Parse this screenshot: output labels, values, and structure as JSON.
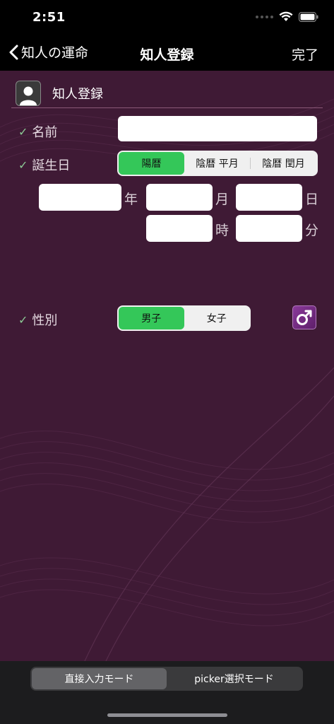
{
  "status_bar": {
    "time": "2:51"
  },
  "nav": {
    "back_label": "知人の運命",
    "title": "知人登録",
    "done_label": "完了"
  },
  "section": {
    "title": "知人登録"
  },
  "name_field": {
    "label": "名前",
    "value": ""
  },
  "birthday": {
    "label": "誕生日",
    "calendar_options": [
      "陽暦",
      "陰暦 平月",
      "陰暦 閏月"
    ],
    "selected_calendar": "陽暦",
    "year_unit": "年",
    "month_unit": "月",
    "day_unit": "日",
    "hour_unit": "時",
    "minute_unit": "分"
  },
  "gender": {
    "label": "性別",
    "options": [
      "男子",
      "女子"
    ],
    "selected": "男子",
    "icon": "male-symbol-icon"
  },
  "bottom_modes": {
    "options": [
      "直接入力モード",
      "picker選択モード"
    ],
    "selected": "直接入力モード"
  },
  "colors": {
    "background": "#3f1a35",
    "accent": "#34c759",
    "check": "#8cc995"
  }
}
